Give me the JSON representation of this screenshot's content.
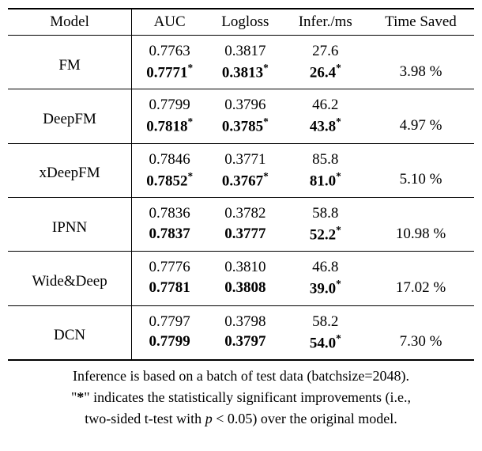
{
  "chart_data": {
    "type": "table",
    "title": "",
    "columns": [
      "Model",
      "AUC",
      "Logloss",
      "Infer./ms",
      "Time Saved"
    ],
    "rows": [
      {
        "model": "FM",
        "baseline": {
          "auc": "0.7763",
          "logloss": "0.3817",
          "infer": "27.6"
        },
        "improved": {
          "auc": "0.7771",
          "auc_sig": true,
          "logloss": "0.3813",
          "logloss_sig": true,
          "infer": "26.4",
          "infer_sig": true
        },
        "time_saved": "3.98 %"
      },
      {
        "model": "DeepFM",
        "baseline": {
          "auc": "0.7799",
          "logloss": "0.3796",
          "infer": "46.2"
        },
        "improved": {
          "auc": "0.7818",
          "auc_sig": true,
          "logloss": "0.3785",
          "logloss_sig": true,
          "infer": "43.8",
          "infer_sig": true
        },
        "time_saved": "4.97 %"
      },
      {
        "model": "xDeepFM",
        "baseline": {
          "auc": "0.7846",
          "logloss": "0.3771",
          "infer": "85.8"
        },
        "improved": {
          "auc": "0.7852",
          "auc_sig": true,
          "logloss": "0.3767",
          "logloss_sig": true,
          "infer": "81.0",
          "infer_sig": true
        },
        "time_saved": "5.10 %"
      },
      {
        "model": "IPNN",
        "baseline": {
          "auc": "0.7836",
          "logloss": "0.3782",
          "infer": "58.8"
        },
        "improved": {
          "auc": "0.7837",
          "auc_sig": false,
          "logloss": "0.3777",
          "logloss_sig": false,
          "infer": "52.2",
          "infer_sig": true
        },
        "time_saved": "10.98 %"
      },
      {
        "model": "Wide&Deep",
        "baseline": {
          "auc": "0.7776",
          "logloss": "0.3810",
          "infer": "46.8"
        },
        "improved": {
          "auc": "0.7781",
          "auc_sig": false,
          "logloss": "0.3808",
          "logloss_sig": false,
          "infer": "39.0",
          "infer_sig": true
        },
        "time_saved": "17.02 %"
      },
      {
        "model": "DCN",
        "baseline": {
          "auc": "0.7797",
          "logloss": "0.3798",
          "infer": "58.2"
        },
        "improved": {
          "auc": "0.7799",
          "auc_sig": false,
          "logloss": "0.3797",
          "logloss_sig": false,
          "infer": "54.0",
          "infer_sig": true
        },
        "time_saved": "7.30 %"
      }
    ]
  },
  "headers": {
    "model": "Model",
    "auc": "AUC",
    "logloss": "Logloss",
    "infer": "Infer./ms",
    "time_saved": "Time Saved"
  },
  "footnote": {
    "line1": "Inference is based on a batch of test data (batchsize=2048).",
    "line2a": "\"",
    "line2star": "*",
    "line2b": "\" indicates the statistically significant improvements (i.e.,",
    "line3a": "two-sided t-test with ",
    "line3p": "p",
    "line3b": " < 0.05) over the original model."
  }
}
